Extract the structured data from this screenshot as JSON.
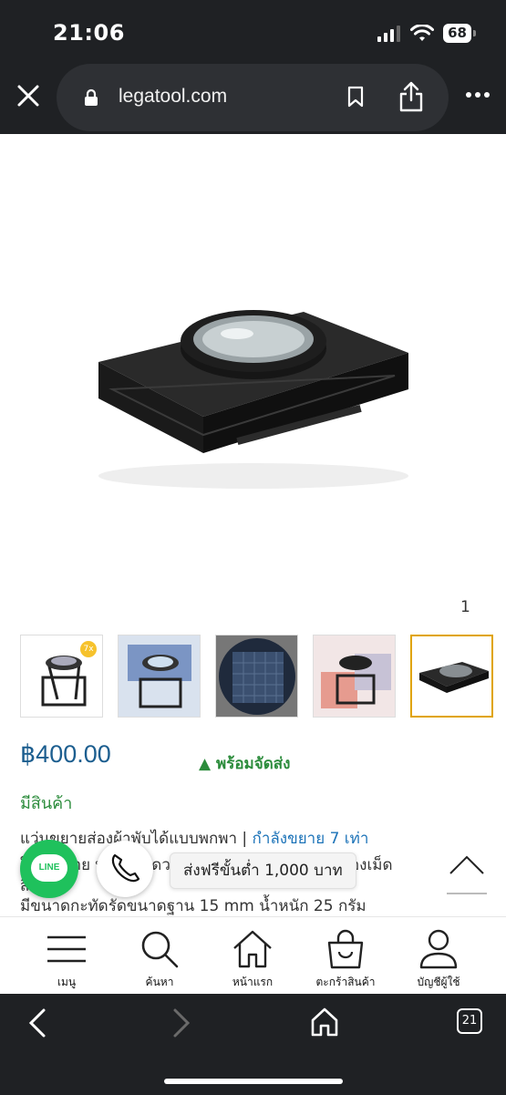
{
  "status": {
    "time": "21:06",
    "battery": "68"
  },
  "browser": {
    "url": "legatool.com",
    "tabs_count": "21"
  },
  "gallery": {
    "counter": "1",
    "thumb_badge": "7x",
    "thumbnails": [
      "thumb-1",
      "thumb-2",
      "thumb-3",
      "thumb-4",
      "thumb-5"
    ],
    "active_index": 4
  },
  "product": {
    "price": "฿400.00",
    "ready_to_ship": "▲ พร้อมจัดส่ง",
    "stock": "มีสินค้า",
    "desc_line1_a": "แว่นขยายส่องผ้าพับได้แบบพกพา | ",
    "desc_line1_b": "กำลังขยาย 7 เท่า",
    "desc_line2": "ใช้งานง่าย พกพาสะดวก ใช้ส่องผ้า ส่องงานพิมพ์ ส่องเม็ด",
    "desc_line3": "สี",
    "desc_line4": "มีขนาดกะทัดรัดขนาดฐาน 15 mm น้ำหนัก 25 กรัม"
  },
  "floating": {
    "line_label": "LINE",
    "free_shipping": "ส่งฟรีขั้นต่ำ 1,000 บาท"
  },
  "site_nav": [
    {
      "label": "เมนู",
      "icon": "menu-icon"
    },
    {
      "label": "ค้นหา",
      "icon": "search-icon"
    },
    {
      "label": "หน้าแรก",
      "icon": "home-icon"
    },
    {
      "label": "ตะกร้าสินค้า",
      "icon": "cart-icon"
    },
    {
      "label": "บัญชีผู้ใช้",
      "icon": "user-icon"
    }
  ],
  "colors": {
    "price": "#1c5e8f",
    "green": "#2c8c3c",
    "link": "#1c73b8",
    "chrome": "#1f2124"
  }
}
